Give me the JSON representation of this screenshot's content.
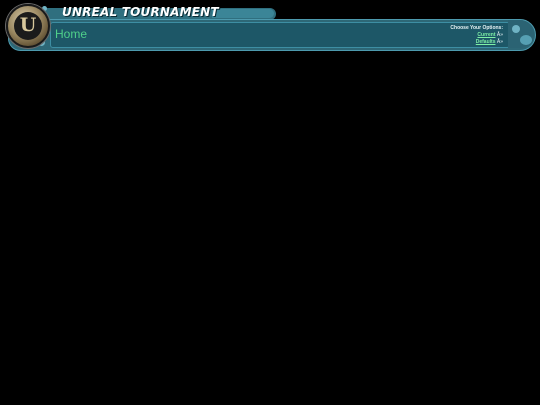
{
  "header": {
    "title": "UNREAL TOURNAMENT",
    "logo_letter": "U",
    "page_title": "Home"
  },
  "options": {
    "label": "Choose Your Options:",
    "links": [
      {
        "label": "Current",
        "suffix": "Â»"
      },
      {
        "label": "Defaults",
        "suffix": "Â»"
      }
    ]
  },
  "colors": {
    "background": "#000000",
    "bar": "#2d6776",
    "panel": "#1d5767",
    "accent_green": "#4fd08a"
  }
}
